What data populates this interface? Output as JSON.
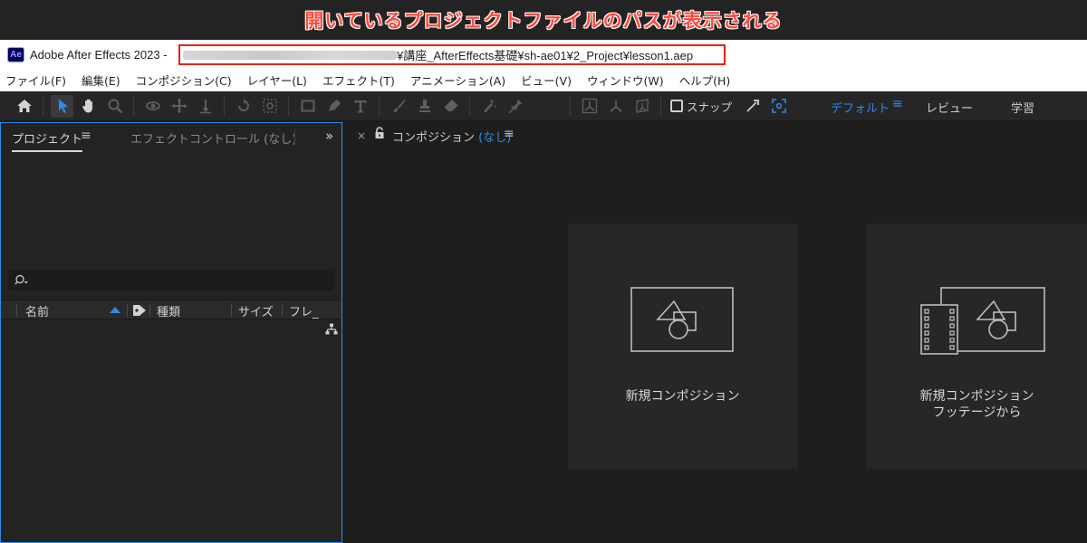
{
  "banner": {
    "text": "開いているプロジェクトファイルのパスが表示される"
  },
  "titlebar": {
    "logo": "Ae",
    "app_title": "Adobe After Effects 2023 -",
    "path_visible": "¥講座_AfterEffects基礎¥sh-ae01¥2_Project¥lesson1.aep"
  },
  "menu": {
    "items": [
      "ファイル(F)",
      "編集(E)",
      "コンポジション(C)",
      "レイヤー(L)",
      "エフェクト(T)",
      "アニメーション(A)",
      "ビュー(V)",
      "ウィンドウ(W)",
      "ヘルプ(H)"
    ]
  },
  "toolbar": {
    "snap_label": "スナップ",
    "workspaces": {
      "default": "デフォルト",
      "menu": "≡",
      "review": "レビュー",
      "learn": "学習"
    }
  },
  "project_panel": {
    "tab_project": "プロジェクト",
    "tab_menu": "≡",
    "tab_effect_controls": "エフェクトコントロール (なし)",
    "more": "»",
    "columns": {
      "name": "名前",
      "type": "種類",
      "size": "サイズ",
      "frame": "フレ_"
    }
  },
  "comp_panel": {
    "close": "×",
    "tab_label": "コンポジション",
    "tab_none": "(なし)",
    "tab_menu": "≡",
    "card_new_comp": "新規コンポジション",
    "card_from_footage_line1": "新規コンポジション",
    "card_from_footage_line2": "フッテージから"
  },
  "colors": {
    "accent": "#2d8ceb",
    "highlight_red": "#e2231a",
    "ae_brand": "#9999ff"
  }
}
